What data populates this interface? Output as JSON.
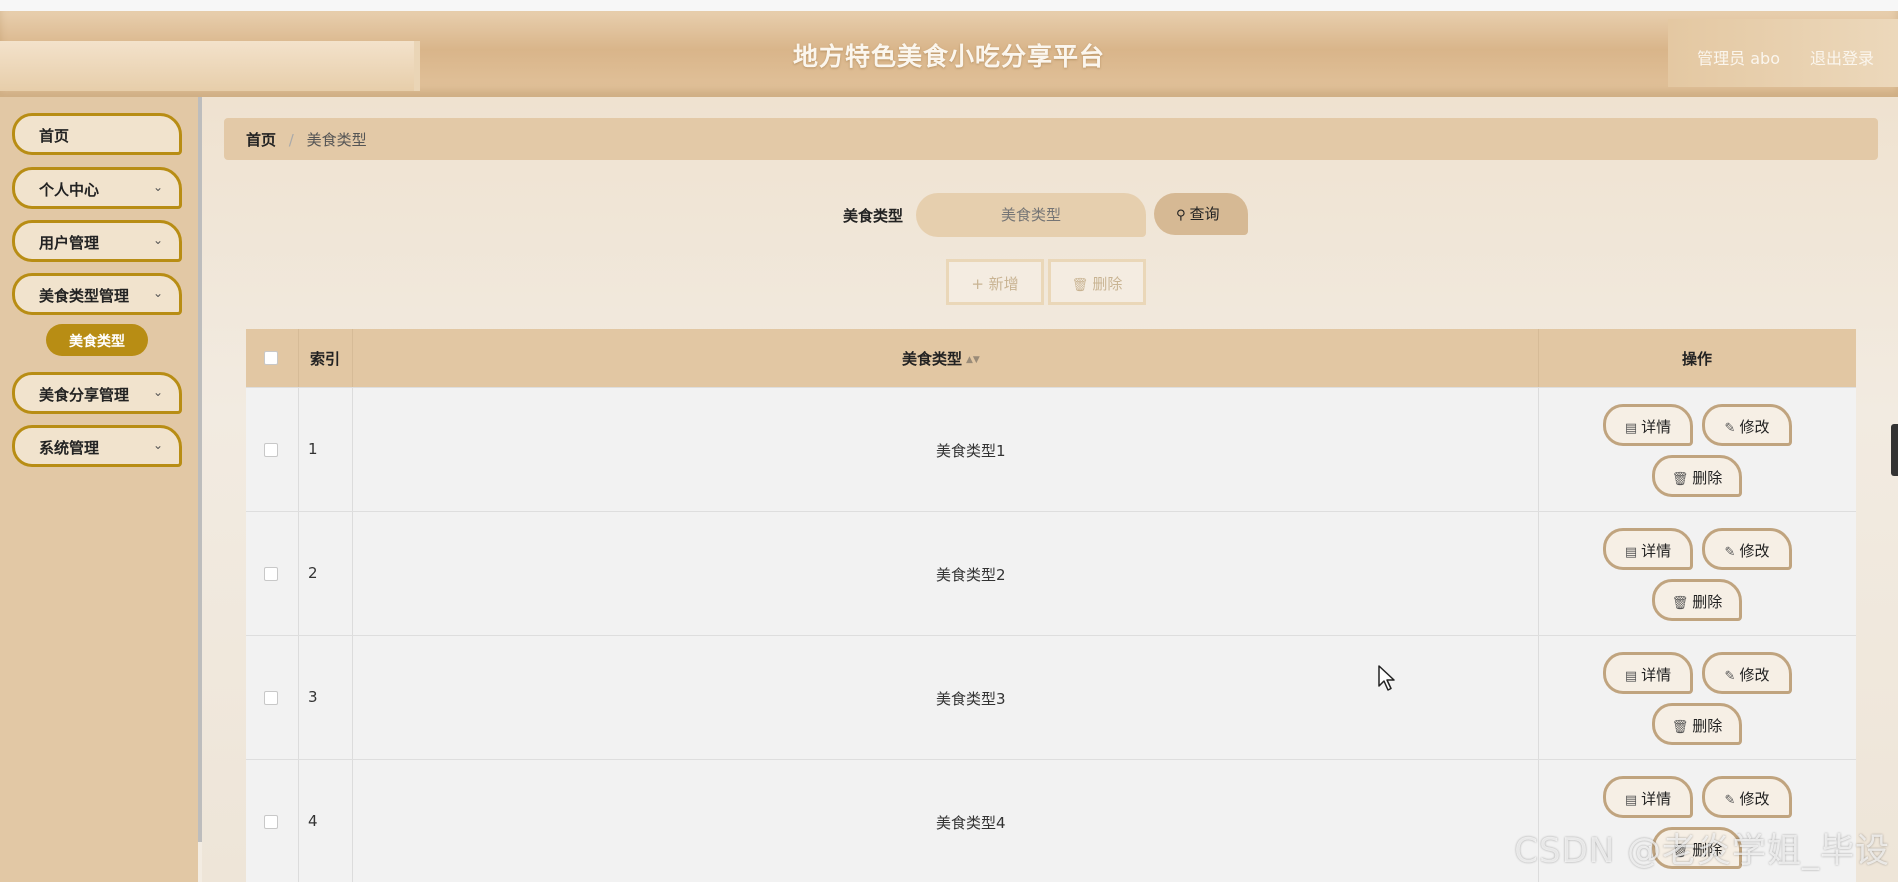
{
  "header": {
    "title": "地方特色美食小吃分享平台",
    "user": "管理员 abo",
    "logout": "退出登录"
  },
  "sidebar": {
    "items": [
      {
        "label": "首页",
        "chevron": false
      },
      {
        "label": "个人中心",
        "chevron": true
      },
      {
        "label": "用户管理",
        "chevron": true
      },
      {
        "label": "美食类型管理",
        "chevron": true
      },
      {
        "label": "美食分享管理",
        "chevron": true
      },
      {
        "label": "系统管理",
        "chevron": true
      }
    ],
    "active_sub": "美食类型"
  },
  "breadcrumb": {
    "home": "首页",
    "separator": "/",
    "current": "美食类型"
  },
  "search": {
    "label": "美食类型",
    "placeholder": "美食类型",
    "button": "查询"
  },
  "actions": {
    "add": "新增",
    "delete": "删除"
  },
  "table": {
    "headers": {
      "index": "索引",
      "type": "美食类型",
      "ops": "操作"
    },
    "rows": [
      {
        "index": "1",
        "type": "美食类型1"
      },
      {
        "index": "2",
        "type": "美食类型2"
      },
      {
        "index": "3",
        "type": "美食类型3"
      },
      {
        "index": "4",
        "type": "美食类型4"
      }
    ],
    "row_buttons": {
      "detail": "详情",
      "edit": "修改",
      "delete": "删除"
    }
  },
  "watermark": "CSDN @老炎学姐_毕设",
  "colors": {
    "accent": "#b88d14",
    "header": "#d9b58a",
    "sidebar": "#e2c8a5"
  }
}
